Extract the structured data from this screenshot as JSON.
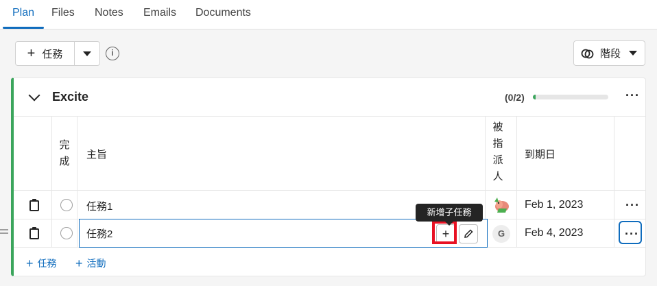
{
  "tabs": [
    {
      "label": "Plan"
    },
    {
      "label": "Files"
    },
    {
      "label": "Notes"
    },
    {
      "label": "Emails"
    },
    {
      "label": "Documents"
    }
  ],
  "toolbar": {
    "add_task_label": "任務",
    "stage_label": "階段"
  },
  "bucket": {
    "title": "Excite",
    "progress_text": "(0/2)",
    "progress_fraction": 0.0,
    "columns": {
      "done": "完\n成",
      "subject": "主旨",
      "assignee": "被\n指\n派\n人",
      "due": "到期日"
    },
    "tasks": [
      {
        "name": "任務1",
        "due": "Feb 1, 2023",
        "assignee": "avatar-image"
      },
      {
        "name": "任務2",
        "due": "Feb 4, 2023",
        "assignee_initial": "G"
      }
    ],
    "tooltip": "新增子任務",
    "footer": {
      "add_task": "任務",
      "add_activity": "活動"
    }
  },
  "colors": {
    "accent": "#0f6cbd",
    "bucket_green": "#3ba55c",
    "highlight_red": "#e81123"
  }
}
